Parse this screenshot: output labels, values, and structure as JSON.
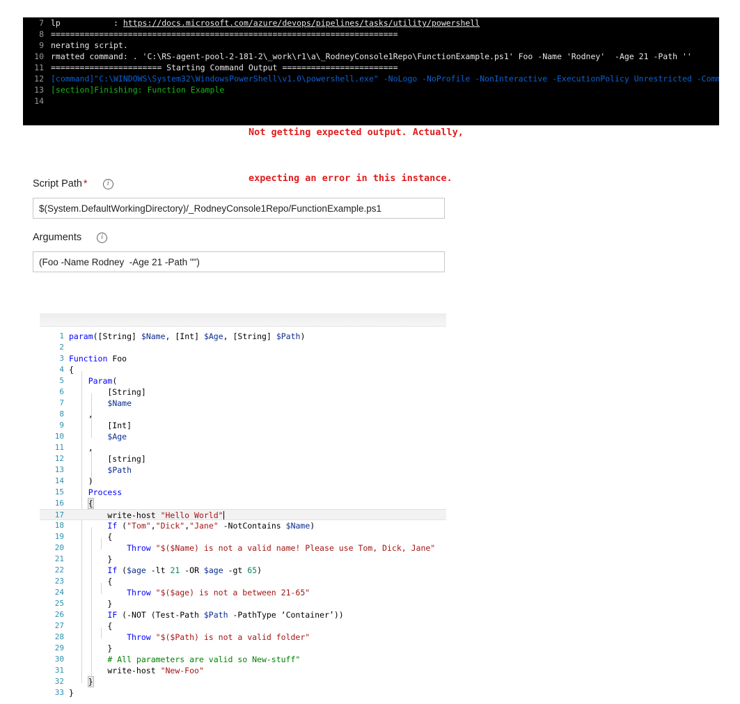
{
  "console": {
    "name": "azure-devops-pipeline-log",
    "annotation_line1": "Not getting expected output. Actually,",
    "annotation_line2": "expecting an error in this instance.",
    "annotation_color": "#e01b1b",
    "background": "#000000",
    "lines": [
      {
        "num": "7",
        "segments": [
          {
            "text": "lp           : ",
            "cls": "c-white"
          },
          {
            "text": "https://docs.microsoft.com/azure/devops/pipelines/tasks/utility/powershell",
            "cls": "c-link"
          }
        ]
      },
      {
        "num": "8",
        "segments": [
          {
            "text": "========================================================================",
            "cls": "c-white"
          }
        ]
      },
      {
        "num": "9",
        "segments": [
          {
            "text": "nerating script.",
            "cls": "c-white"
          }
        ]
      },
      {
        "num": "10",
        "segments": [
          {
            "text": "rmatted command: . 'C:\\RS-agent-pool-2-181-2\\_work\\r1\\a\\_RodneyConsole1Repo\\FunctionExample.ps1' Foo -Name 'Rodney'  -Age 21 -Path ''",
            "cls": "c-white"
          }
        ]
      },
      {
        "num": "11",
        "segments": [
          {
            "text": "======================= Starting Command Output ========================",
            "cls": "c-white"
          }
        ]
      },
      {
        "num": "12",
        "segments": [
          {
            "text": "[command]\"C:\\WINDOWS\\System32\\WindowsPowerShell\\v1.0\\powershell.exe\" -NoLogo -NoProfile -NonInteractive -ExecutionPolicy Unrestricted -Comma",
            "cls": "c-blue"
          }
        ]
      },
      {
        "num": "13",
        "segments": [
          {
            "text": "[section]Finishing: Function Example",
            "cls": "c-green"
          }
        ]
      },
      {
        "num": "14",
        "segments": [
          {
            "text": "",
            "cls": "c-white"
          }
        ]
      }
    ]
  },
  "form": {
    "script_path": {
      "label": "Script Path",
      "required_marker": "*",
      "info_icon": "info-icon",
      "value": "$(System.DefaultWorkingDirectory)/_RodneyConsole1Repo/FunctionExample.ps1",
      "placeholder": "Script Path"
    },
    "arguments": {
      "label": "Arguments",
      "info_icon": "info-icon",
      "value": "(Foo -Name Rodney  -Age 21 -Path \"\")",
      "placeholder": "Arguments"
    }
  },
  "editor": {
    "language": "powershell",
    "current_line": 17,
    "total_lines": 33,
    "lines": [
      {
        "num": "1",
        "segments": [
          {
            "text": "param",
            "cls": "t-kw"
          },
          {
            "text": "([",
            "cls": "t-op"
          },
          {
            "text": "String",
            "cls": "t-op"
          },
          {
            "text": "] ",
            "cls": "t-op"
          },
          {
            "text": "$Name",
            "cls": "t-var"
          },
          {
            "text": ", [",
            "cls": "t-op"
          },
          {
            "text": "Int",
            "cls": "t-op"
          },
          {
            "text": "] ",
            "cls": "t-op"
          },
          {
            "text": "$Age",
            "cls": "t-var"
          },
          {
            "text": ", [",
            "cls": "t-op"
          },
          {
            "text": "String",
            "cls": "t-op"
          },
          {
            "text": "] ",
            "cls": "t-op"
          },
          {
            "text": "$Path",
            "cls": "t-var"
          },
          {
            "text": ")",
            "cls": "t-op"
          }
        ]
      },
      {
        "num": "2",
        "segments": [
          {
            "text": "",
            "cls": "t-op"
          }
        ]
      },
      {
        "num": "3",
        "segments": [
          {
            "text": "Function",
            "cls": "t-kw"
          },
          {
            "text": " Foo",
            "cls": "t-op"
          }
        ]
      },
      {
        "num": "4",
        "segments": [
          {
            "text": "{",
            "cls": "t-brk"
          }
        ]
      },
      {
        "num": "5",
        "segments": [
          {
            "text": "    ",
            "cls": "t-op"
          },
          {
            "text": "Param",
            "cls": "t-kw"
          },
          {
            "text": "(",
            "cls": "t-op"
          }
        ]
      },
      {
        "num": "6",
        "segments": [
          {
            "text": "        [String]",
            "cls": "t-op"
          }
        ]
      },
      {
        "num": "7",
        "segments": [
          {
            "text": "        ",
            "cls": "t-op"
          },
          {
            "text": "$Name",
            "cls": "t-var"
          }
        ]
      },
      {
        "num": "8",
        "segments": [
          {
            "text": "    ,",
            "cls": "t-op"
          }
        ]
      },
      {
        "num": "9",
        "segments": [
          {
            "text": "        [Int]",
            "cls": "t-op"
          }
        ]
      },
      {
        "num": "10",
        "segments": [
          {
            "text": "        ",
            "cls": "t-op"
          },
          {
            "text": "$Age",
            "cls": "t-var"
          }
        ]
      },
      {
        "num": "11",
        "segments": [
          {
            "text": "    ,",
            "cls": "t-op"
          }
        ]
      },
      {
        "num": "12",
        "segments": [
          {
            "text": "        [string]",
            "cls": "t-op"
          }
        ]
      },
      {
        "num": "13",
        "segments": [
          {
            "text": "        ",
            "cls": "t-op"
          },
          {
            "text": "$Path",
            "cls": "t-var"
          }
        ]
      },
      {
        "num": "14",
        "segments": [
          {
            "text": "    )",
            "cls": "t-op"
          }
        ]
      },
      {
        "num": "15",
        "segments": [
          {
            "text": "    ",
            "cls": "t-op"
          },
          {
            "text": "Process",
            "cls": "t-kw"
          }
        ]
      },
      {
        "num": "16",
        "segments": [
          {
            "text": "    ",
            "cls": "t-op"
          },
          {
            "text": "{",
            "cls": "bracket-box"
          }
        ]
      },
      {
        "num": "17",
        "segments": [
          {
            "text": "        write-host ",
            "cls": "t-op"
          },
          {
            "text": "\"Hello World\"",
            "cls": "t-str"
          }
        ]
      },
      {
        "num": "18",
        "segments": [
          {
            "text": "        ",
            "cls": "t-op"
          },
          {
            "text": "If",
            "cls": "t-kw"
          },
          {
            "text": " (",
            "cls": "t-op"
          },
          {
            "text": "\"Tom\"",
            "cls": "t-str"
          },
          {
            "text": ",",
            "cls": "t-op"
          },
          {
            "text": "\"Dick\"",
            "cls": "t-str"
          },
          {
            "text": ",",
            "cls": "t-op"
          },
          {
            "text": "\"Jane\"",
            "cls": "t-str"
          },
          {
            "text": " -NotContains ",
            "cls": "t-op"
          },
          {
            "text": "$Name",
            "cls": "t-var"
          },
          {
            "text": ")",
            "cls": "t-op"
          }
        ]
      },
      {
        "num": "19",
        "segments": [
          {
            "text": "        {",
            "cls": "t-op"
          }
        ]
      },
      {
        "num": "20",
        "segments": [
          {
            "text": "            ",
            "cls": "t-op"
          },
          {
            "text": "Throw",
            "cls": "t-kw"
          },
          {
            "text": " \"$($Name) is not a valid name! Please use Tom, Dick, Jane\"",
            "cls": "t-str"
          }
        ]
      },
      {
        "num": "21",
        "segments": [
          {
            "text": "        }",
            "cls": "t-op"
          }
        ]
      },
      {
        "num": "22",
        "segments": [
          {
            "text": "        ",
            "cls": "t-op"
          },
          {
            "text": "If",
            "cls": "t-kw"
          },
          {
            "text": " (",
            "cls": "t-op"
          },
          {
            "text": "$age",
            "cls": "t-var"
          },
          {
            "text": " -lt ",
            "cls": "t-op"
          },
          {
            "text": "21",
            "cls": "t-num"
          },
          {
            "text": " -OR ",
            "cls": "t-op"
          },
          {
            "text": "$age",
            "cls": "t-var"
          },
          {
            "text": " -gt ",
            "cls": "t-op"
          },
          {
            "text": "65",
            "cls": "t-num"
          },
          {
            "text": ")",
            "cls": "t-op"
          }
        ]
      },
      {
        "num": "23",
        "segments": [
          {
            "text": "        {",
            "cls": "t-op"
          }
        ]
      },
      {
        "num": "24",
        "segments": [
          {
            "text": "            ",
            "cls": "t-op"
          },
          {
            "text": "Throw",
            "cls": "t-kw"
          },
          {
            "text": " \"$($age) is not a between 21-65\"",
            "cls": "t-str"
          }
        ]
      },
      {
        "num": "25",
        "segments": [
          {
            "text": "        }",
            "cls": "t-op"
          }
        ]
      },
      {
        "num": "26",
        "segments": [
          {
            "text": "        ",
            "cls": "t-op"
          },
          {
            "text": "IF",
            "cls": "t-kw"
          },
          {
            "text": " (-NOT (Test-Path ",
            "cls": "t-op"
          },
          {
            "text": "$Path",
            "cls": "t-var"
          },
          {
            "text": " -PathType ‘Container’))",
            "cls": "t-op"
          }
        ]
      },
      {
        "num": "27",
        "segments": [
          {
            "text": "        {",
            "cls": "t-op"
          }
        ]
      },
      {
        "num": "28",
        "segments": [
          {
            "text": "            ",
            "cls": "t-op"
          },
          {
            "text": "Throw",
            "cls": "t-kw"
          },
          {
            "text": " \"$($Path) is not a valid folder\"",
            "cls": "t-str"
          }
        ]
      },
      {
        "num": "29",
        "segments": [
          {
            "text": "        }",
            "cls": "t-op"
          }
        ]
      },
      {
        "num": "30",
        "segments": [
          {
            "text": "        # All parameters are valid so New-stuff\"",
            "cls": "t-com"
          }
        ]
      },
      {
        "num": "31",
        "segments": [
          {
            "text": "        write-host ",
            "cls": "t-op"
          },
          {
            "text": "\"New-Foo\"",
            "cls": "t-str"
          }
        ]
      },
      {
        "num": "32",
        "segments": [
          {
            "text": "    ",
            "cls": "t-op"
          },
          {
            "text": "}",
            "cls": "bracket-box"
          }
        ]
      },
      {
        "num": "33",
        "segments": [
          {
            "text": "}",
            "cls": "t-op"
          }
        ]
      }
    ]
  }
}
